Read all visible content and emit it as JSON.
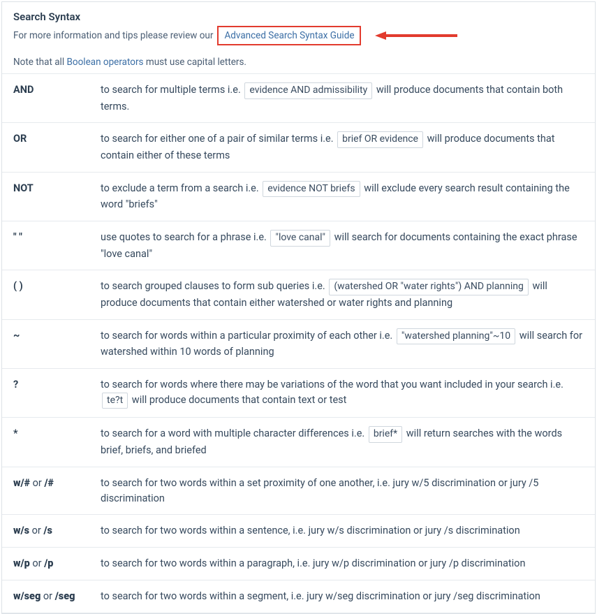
{
  "header": {
    "title": "Search Syntax",
    "subtitle_prefix": "For more information and tips please review our ",
    "guide_link": "Advanced Search Syntax Guide"
  },
  "note": {
    "prefix": "Note that all ",
    "link": "Boolean operators",
    "suffix": " must use capital letters."
  },
  "rows": [
    {
      "op_html": "AND",
      "parts": [
        {
          "t": "text",
          "v": "to search for multiple terms i.e. "
        },
        {
          "t": "chip",
          "v": "evidence AND admissibility"
        },
        {
          "t": "text",
          "v": " will produce documents that contain both terms."
        }
      ]
    },
    {
      "op_html": "OR",
      "parts": [
        {
          "t": "text",
          "v": "to search for either one of a pair of similar terms i.e. "
        },
        {
          "t": "chip",
          "v": "brief OR evidence"
        },
        {
          "t": "text",
          "v": " will produce documents that contain either of these terms"
        }
      ]
    },
    {
      "op_html": "NOT",
      "parts": [
        {
          "t": "text",
          "v": "to exclude a term from a search i.e. "
        },
        {
          "t": "chip",
          "v": "evidence NOT briefs"
        },
        {
          "t": "text",
          "v": " will exclude every search result containing the word \"briefs\""
        }
      ]
    },
    {
      "op_html": "\" \"",
      "parts": [
        {
          "t": "text",
          "v": "use quotes to search for a phrase i.e. "
        },
        {
          "t": "chip",
          "v": "\"love canal\""
        },
        {
          "t": "text",
          "v": " will search for documents containing the exact phrase \"love canal\""
        }
      ]
    },
    {
      "op_html": "( )",
      "parts": [
        {
          "t": "text",
          "v": "to search grouped clauses to form sub queries i.e. "
        },
        {
          "t": "chip",
          "v": "(watershed OR \"water rights\") AND planning"
        },
        {
          "t": "text",
          "v": " will produce documents that contain either watershed or water rights and planning"
        }
      ]
    },
    {
      "op_html": "~",
      "parts": [
        {
          "t": "text",
          "v": "to search for words within a particular proximity of each other i.e. "
        },
        {
          "t": "chip",
          "v": "\"watershed planning\"~10"
        },
        {
          "t": "text",
          "v": " will search for watershed within 10 words of planning"
        }
      ]
    },
    {
      "op_html": "?",
      "parts": [
        {
          "t": "text",
          "v": "to search for words where there may be variations of the word that you want included in your search i.e. "
        },
        {
          "t": "chip",
          "v": "te?t"
        },
        {
          "t": "text",
          "v": " will produce documents that contain text or test"
        }
      ]
    },
    {
      "op_html": "*",
      "parts": [
        {
          "t": "text",
          "v": "to search for a word with multiple character differences i.e. "
        },
        {
          "t": "chip",
          "v": "brief*"
        },
        {
          "t": "text",
          "v": " will return searches with the words brief, briefs, and briefed"
        }
      ]
    },
    {
      "op_html": "<b>w/#</b><span class=\"op-alt-normal\"> or </span><b>/#</b>",
      "parts": [
        {
          "t": "text",
          "v": "to search for two words within a set proximity of one another, i.e. jury w/5 discrimination or jury /5 discrimination"
        }
      ]
    },
    {
      "op_html": "<b>w/s</b><span class=\"op-alt-normal\"> or </span><b>/s</b>",
      "parts": [
        {
          "t": "text",
          "v": "to search for two words within a sentence, i.e. jury w/s discrimination or jury /s discrimination"
        }
      ]
    },
    {
      "op_html": "<b>w/p</b><span class=\"op-alt-normal\"> or </span><b>/p</b>",
      "parts": [
        {
          "t": "text",
          "v": "to search for two words within a paragraph, i.e. jury w/p discrimination or jury /p discrimination"
        }
      ]
    },
    {
      "op_html": "<b>w/seg</b><span class=\"op-alt-normal\"> or </span><b>/seg</b>",
      "parts": [
        {
          "t": "text",
          "v": "to search for two words within a segment, i.e. jury w/seg discrimination or jury /seg discrimination"
        }
      ]
    }
  ]
}
